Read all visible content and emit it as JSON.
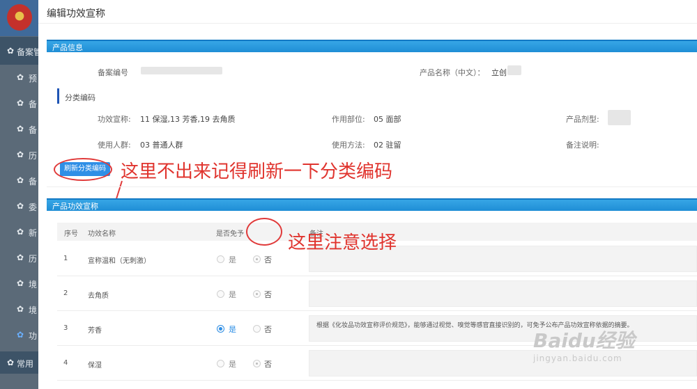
{
  "sidebar": {
    "group_label": "备案管",
    "items": [
      {
        "label": "预"
      },
      {
        "label": "备"
      },
      {
        "label": "备"
      },
      {
        "label": "历"
      },
      {
        "label": "备"
      },
      {
        "label": "委"
      },
      {
        "label": "新"
      },
      {
        "label": "历"
      },
      {
        "label": "境"
      },
      {
        "label": "境"
      },
      {
        "label": "功"
      }
    ],
    "bottom_group_label": "常用"
  },
  "modal": {
    "title": "编辑功效宣称",
    "product_info": {
      "section_title": "产品信息",
      "record_no_label": "备案编号",
      "product_name_label": "产品名称（中文）：",
      "product_name_value": "立创"
    },
    "classification": {
      "heading": "分类编码",
      "claim_label": "功效宣称:",
      "claim_value": "11 保湿,13 芳香,19 去角质",
      "body_part_label": "作用部位:",
      "body_part_value": "05 面部",
      "form_label": "产品剂型:",
      "population_label": "使用人群:",
      "population_value": "03 普通人群",
      "method_label": "使用方法:",
      "method_value": "02 驻留",
      "remark_label": "备注说明:",
      "refresh_button": "刷新分类编码"
    },
    "claims": {
      "section_title": "产品功效宣称",
      "headers": {
        "no": "序号",
        "name": "功效名称",
        "exempt": "是否免予",
        "remark": "备注"
      },
      "yes_label": "是",
      "no_label": "否",
      "rows": [
        {
          "no": "1",
          "name": "宣称温和（无刺激）",
          "exempt": "no",
          "remark": ""
        },
        {
          "no": "2",
          "name": "去角质",
          "exempt": "no",
          "remark": ""
        },
        {
          "no": "3",
          "name": "芳香",
          "exempt": "yes",
          "remark": "根据《化妆品功效宣称评价规范》，能够通过视觉、嗅觉等感官直接识别的，可免予公布产品功效宣称依据的摘要。"
        },
        {
          "no": "4",
          "name": "保湿",
          "exempt": "no",
          "remark": ""
        }
      ]
    }
  },
  "annotations": {
    "refresh_note": "这里不出来记得刷新一下分类编码",
    "select_note": "这里注意选择"
  },
  "watermark": {
    "logo": "Baidu经验",
    "url": "jingyan.baidu.com"
  },
  "colors": {
    "section_bar": "#1f8ed6",
    "primary_button": "#2f8fe6",
    "annotation": "#e0342e",
    "sidebar": "#5b6a78"
  }
}
